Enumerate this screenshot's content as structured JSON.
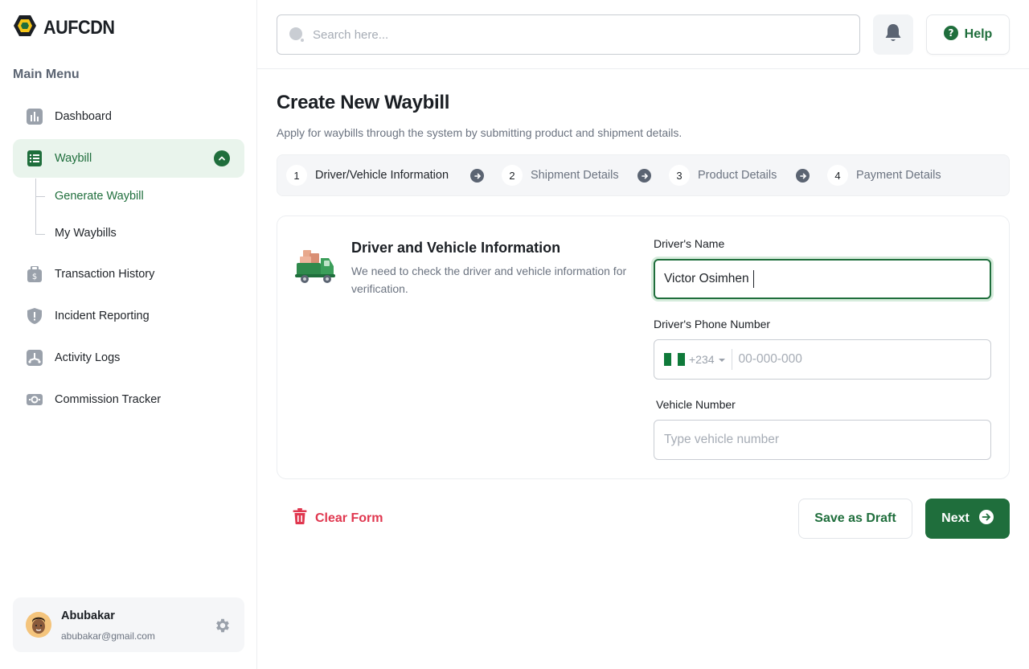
{
  "brand": {
    "name": "AUFCDN",
    "logo_icon": "hexagon-logo-icon"
  },
  "colors": {
    "accent": "#1f6e3c",
    "accent_light": "#e9f4ec",
    "danger": "#e0374f",
    "muted": "#6b7380"
  },
  "sidebar": {
    "heading": "Main Menu",
    "items": [
      {
        "label": "Dashboard",
        "icon": "bar-chart-icon"
      },
      {
        "label": "Waybill",
        "icon": "document-list-icon",
        "active": true,
        "expanded": true,
        "children": [
          {
            "label": "Generate Waybill",
            "active": true
          },
          {
            "label": "My Waybills"
          }
        ]
      },
      {
        "label": "Transaction History",
        "icon": "wallet-icon"
      },
      {
        "label": "Incident Reporting",
        "icon": "shield-alert-icon"
      },
      {
        "label": "Activity Logs",
        "icon": "activity-icon"
      },
      {
        "label": "Commission Tracker",
        "icon": "cash-icon"
      }
    ],
    "user": {
      "name": "Abubakar",
      "email": "abubakar@gmail.com"
    }
  },
  "topbar": {
    "search_placeholder": "Search here...",
    "help_label": "Help"
  },
  "page": {
    "title": "Create New Waybill",
    "subtitle": "Apply for waybills through the system by submitting product and shipment details."
  },
  "steps": [
    {
      "number": "1",
      "label": "Driver/Vehicle Information",
      "current": true
    },
    {
      "number": "2",
      "label": "Shipment Details"
    },
    {
      "number": "3",
      "label": "Product Details"
    },
    {
      "number": "4",
      "label": "Payment Details"
    }
  ],
  "form": {
    "section_title": "Driver and Vehicle Information",
    "section_desc": "We need to check the driver and vehicle information for verification.",
    "driver_name": {
      "label": "Driver's Name",
      "value": "Victor Osimhen"
    },
    "driver_phone": {
      "label": "Driver's Phone Number",
      "country_code": "+234",
      "placeholder": "00-000-000"
    },
    "vehicle_number": {
      "label": "Vehicle Number",
      "placeholder": "Type vehicle number"
    }
  },
  "actions": {
    "clear_label": "Clear Form",
    "draft_label": "Save as Draft",
    "next_label": "Next"
  }
}
